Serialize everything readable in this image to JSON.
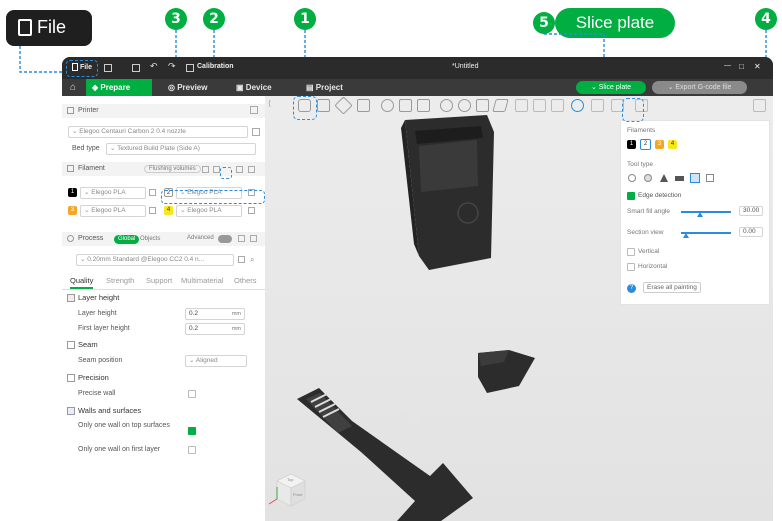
{
  "file_badge": {
    "label": "File"
  },
  "callouts": {
    "c1": "1",
    "c2": "2",
    "c3": "3",
    "c4": "4",
    "c5": "5"
  },
  "slice_banner": {
    "label": "Slice plate"
  },
  "titlebar": {
    "file": "File",
    "calibration": "Calibration",
    "title": "*Untitled",
    "window_controls": [
      "—",
      "□",
      "✕"
    ]
  },
  "tabs": {
    "prepare": "Prepare",
    "preview": "Preview",
    "device": "Device",
    "project": "Project"
  },
  "actions": {
    "slice_plate": "Slice plate",
    "export": "Export G-code file"
  },
  "printer": {
    "header": "Printer",
    "name": "Elegoo Centauri Carbon 2 0.4 nozzle",
    "bed_label": "Bed type",
    "bed_value": "Textured Build Plate (Side A)"
  },
  "filament": {
    "header": "Filament",
    "flushing": "Flushing volumes",
    "slots": [
      {
        "num": "1",
        "color": "#000000",
        "name": "Elegoo PLA"
      },
      {
        "num": "2",
        "color": "#ffffff",
        "name": "Elegoo PLA"
      },
      {
        "num": "3",
        "color": "#f5a623",
        "name": "Elegoo PLA"
      },
      {
        "num": "4",
        "color": "#f8e71c",
        "name": "Elegoo PLA"
      }
    ]
  },
  "process": {
    "header": "Process",
    "global": "Global",
    "objects": "Objects",
    "advanced": "Advanced",
    "preset": "0.20mm Standard @Elegoo CC2 0.4 n...",
    "tabs": [
      "Quality",
      "Strength",
      "Support",
      "Multimaterial",
      "Others"
    ]
  },
  "quality": {
    "layer_height_header": "Layer height",
    "layer_height": "Layer height",
    "layer_height_val": "0.2",
    "first_layer_height": "First layer height",
    "first_layer_height_val": "0.2",
    "unit": "mm",
    "seam_header": "Seam",
    "seam_position": "Seam position",
    "seam_position_val": "Aligned",
    "precision_header": "Precision",
    "precise_wall": "Precise wall",
    "walls_header": "Walls and surfaces",
    "one_wall_top": "Only one wall on top surfaces",
    "one_wall_first": "Only one wall on first layer"
  },
  "paint_panel": {
    "filaments_label": "Filaments",
    "chips": [
      "1",
      "2",
      "3",
      "4"
    ],
    "tool_type": "Tool type",
    "edge_detection": "Edge detection",
    "smart_fill_angle": "Smart fill angle",
    "smart_fill_val": "30.00",
    "section_view": "Section view",
    "section_val": "0.00",
    "vertical": "Vertical",
    "horizontal": "Horizontal",
    "erase": "Erase all painting"
  },
  "model": {
    "logo": "ELEGOO"
  },
  "nav_cube": {
    "top": "Top",
    "front": "Front"
  },
  "colors": {
    "accent": "#00AE42",
    "callout_outline": "#2a8cdc"
  }
}
